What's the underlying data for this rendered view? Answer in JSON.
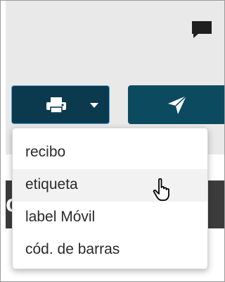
{
  "icons": {
    "chat": "chat-bubble-icon",
    "print": "printer-icon",
    "caret": "caret-down-icon",
    "send": "paper-plane-icon",
    "cursor": "hand-pointer-icon"
  },
  "colors": {
    "button_bg": "#0b3a4f",
    "send_bg": "#0b4a5f",
    "focus_border": "#5aa0d8",
    "panel_bg": "#e9e9e9",
    "strip_bg": "#3c3c3c"
  },
  "background_strip": {
    "partial_text": "c"
  },
  "print_menu": {
    "items": [
      {
        "label": "recibo"
      },
      {
        "label": "etiqueta",
        "hovered": true
      },
      {
        "label": "label Móvil"
      },
      {
        "label": "cód. de barras"
      }
    ]
  }
}
